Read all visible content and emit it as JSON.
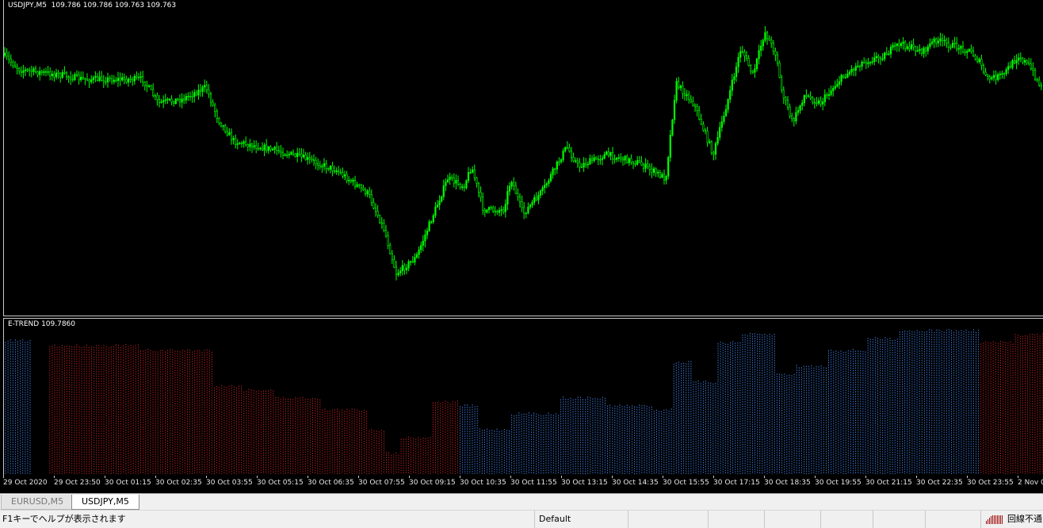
{
  "main_chart": {
    "label": "USDJPY,M5  109.786 109.786 109.763 109.763",
    "candle_color": "#00ff00"
  },
  "indicator": {
    "label": "E-TREND 109.7860",
    "colors": {
      "up": "#3c78d8",
      "down": "#b42020"
    }
  },
  "time_labels": [
    "29 Oct 2020",
    "29 Oct 23:50",
    "30 Oct 01:15",
    "30 Oct 02:35",
    "30 Oct 03:55",
    "30 Oct 05:15",
    "30 Oct 06:35",
    "30 Oct 07:55",
    "30 Oct 09:15",
    "30 Oct 10:35",
    "30 Oct 11:55",
    "30 Oct 13:15",
    "30 Oct 14:35",
    "30 Oct 15:55",
    "30 Oct 17:15",
    "30 Oct 18:35",
    "30 Oct 19:55",
    "30 Oct 21:15",
    "30 Oct 22:35",
    "30 Oct 23:55",
    "2 Nov 0"
  ],
  "tabs": [
    {
      "label": "EURUSD,M5",
      "active": false
    },
    {
      "label": "USDJPY,M5",
      "active": true
    }
  ],
  "status": {
    "help": "F1キーでヘルプが表示されます",
    "profile": "Default",
    "connection": "回線不通"
  },
  "icons": {
    "connection": "connection-bars-icon"
  }
}
